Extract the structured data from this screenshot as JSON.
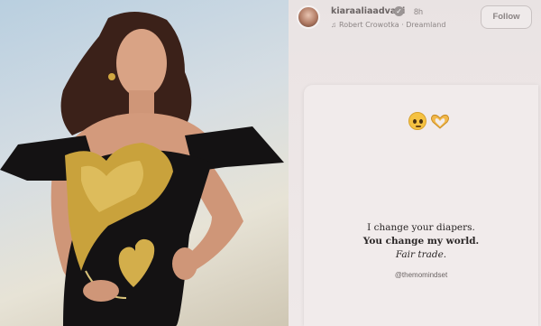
{
  "header": {
    "username": "kiaraaliaadvani",
    "time": "8h",
    "music": "Robert Crowotka · Dreamland",
    "follow_label": "Follow"
  },
  "post": {
    "emojis": [
      "pleading-face",
      "heart-hands"
    ],
    "line1": "I change your diapers.",
    "line2": "You change my world.",
    "line3": "Fair trade.",
    "handle": "@themomindset"
  },
  "colors": {
    "card_bg": "#f1ebeb",
    "panel_bg": "#ece5e5",
    "dress_black": "#141213",
    "gold": "#c9a23c"
  }
}
